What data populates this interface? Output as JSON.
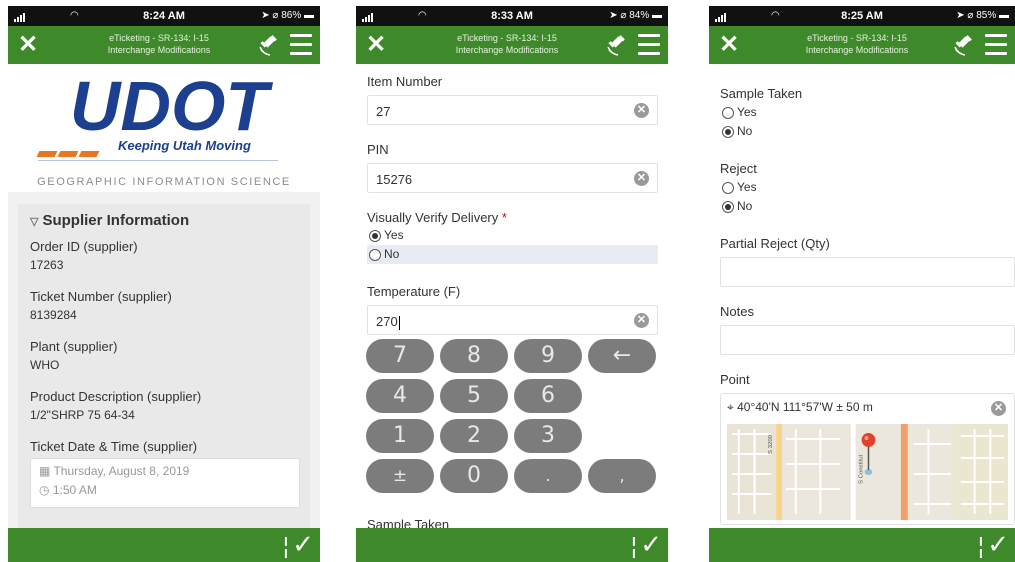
{
  "status_bars": [
    {
      "time": "8:24 AM",
      "battery": "86%"
    },
    {
      "time": "8:33 AM",
      "battery": "84%"
    },
    {
      "time": "8:25 AM",
      "battery": "85%"
    }
  ],
  "header": {
    "title_line1": "eTicketing - SR-134: I-15",
    "title_line2": "Interchange Modifications"
  },
  "screen1": {
    "logo_text": "UDOT",
    "tagline": "Keeping Utah Moving",
    "subtitle": "GEOGRAPHIC INFORMATION SCIENCE",
    "section_title": "Supplier Information",
    "fields": [
      {
        "label": "Order ID (supplier)",
        "value": "17263"
      },
      {
        "label": "Ticket Number (supplier)",
        "value": "8139284"
      },
      {
        "label": "Plant (supplier)",
        "value": "WHO"
      },
      {
        "label": "Product Description (supplier)",
        "value": "1/2\"SHRP 75 64-34"
      }
    ],
    "datetime_label": "Ticket Date & Time (supplier)",
    "date_value": "Thursday, August 8, 2019",
    "time_value": "1:50 AM"
  },
  "screen2": {
    "item_number_label": "Item Number",
    "item_number_value": "27",
    "pin_label": "PIN",
    "pin_value": "15276",
    "verify_label": "Visually Verify Delivery",
    "required_mark": "*",
    "yes_label": "Yes",
    "no_label": "No",
    "temperature_label": "Temperature (F)",
    "temperature_value": "270",
    "keys": [
      "7",
      "8",
      "9",
      "←",
      "4",
      "5",
      "6",
      "1",
      "2",
      "3",
      "±",
      "0",
      ".",
      ","
    ],
    "sample_label": "Sample Taken"
  },
  "screen3": {
    "sample_label": "Sample Taken",
    "reject_label": "Reject",
    "yes_label": "Yes",
    "no_label": "No",
    "partial_label": "Partial Reject (Qty)",
    "notes_label": "Notes",
    "point_label": "Point",
    "coordinates": "40°40'N 111°57'W ± 50 m",
    "map_street1": "S 3200",
    "map_street2": "S Constitut"
  },
  "colors": {
    "header_green": "#3e8a2a",
    "udot_blue": "#1c3f8f",
    "udot_orange": "#e87722"
  }
}
